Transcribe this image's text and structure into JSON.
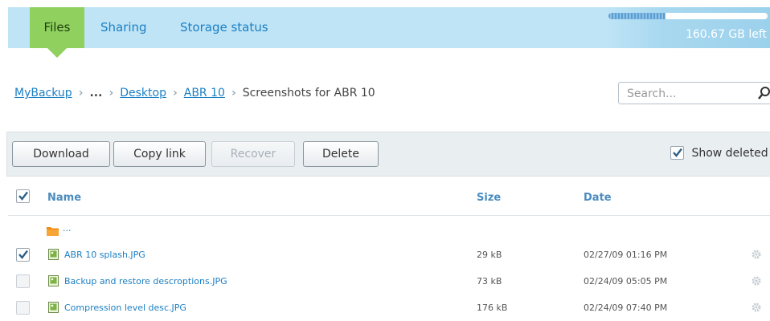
{
  "tabs": [
    {
      "label": "Files",
      "active": true
    },
    {
      "label": "Sharing",
      "active": false
    },
    {
      "label": "Storage status",
      "active": false
    }
  ],
  "storage": {
    "left_text": "160.67 GB left",
    "used_fraction": 0.36
  },
  "breadcrumb": {
    "items": [
      "MyBackup",
      "...",
      "Desktop",
      "ABR 10",
      "Screenshots for ABR 10"
    ]
  },
  "search": {
    "placeholder": "Search..."
  },
  "toolbar": {
    "download_label": "Download",
    "copy_link_label": "Copy link",
    "recover_label": "Recover",
    "delete_label": "Delete",
    "show_deleted_label": "Show deleted"
  },
  "table": {
    "columns": {
      "name": "Name",
      "size": "Size",
      "date": "Date"
    },
    "parent_label": "...",
    "rows": [
      {
        "name": "ABR 10 splash.JPG",
        "size": "29 kB",
        "date": "02/27/09 01:16 PM",
        "checked": true
      },
      {
        "name": "Backup and restore descroptions.JPG",
        "size": "73 kB",
        "date": "02/24/09 05:05 PM",
        "checked": false
      },
      {
        "name": "Compression level desc.JPG",
        "size": "176 kB",
        "date": "02/24/09 07:40 PM",
        "checked": false
      }
    ]
  },
  "colors": {
    "accent": "#1b7fc4",
    "tab_active": "#8fd05f",
    "topbar": "#bfe4f6"
  }
}
